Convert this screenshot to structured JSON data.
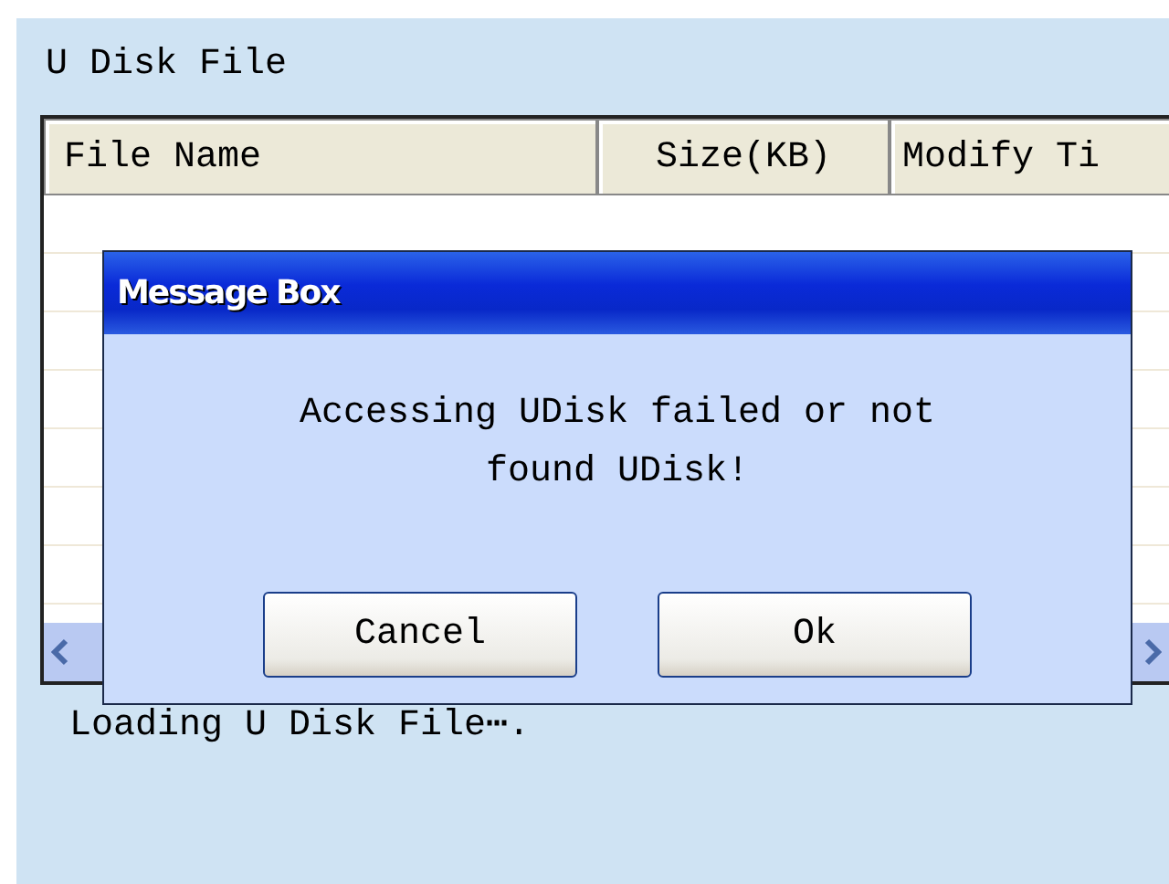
{
  "panel": {
    "title": "U Disk File"
  },
  "table": {
    "columns": [
      "File Name",
      "Size(KB)",
      "Modify Ti"
    ]
  },
  "status_bar": {
    "text": "Loading U Disk File⋯."
  },
  "dialog": {
    "title": "Message Box",
    "message": "Accessing UDisk failed or not found UDisk!",
    "buttons": [
      "Cancel",
      "Ok"
    ]
  }
}
